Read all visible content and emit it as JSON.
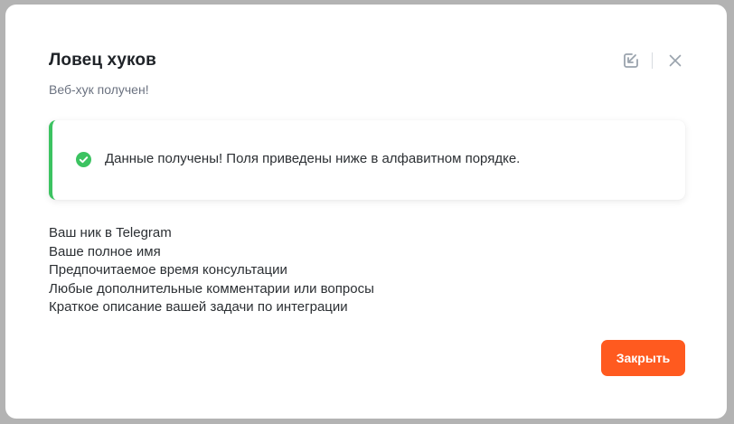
{
  "modal": {
    "title": "Ловец хуков",
    "subtitle": "Веб-хук получен!"
  },
  "header_actions": {
    "icons": [
      "open-external-icon",
      "close-icon"
    ]
  },
  "alert": {
    "status": "success",
    "icon": "check-circle-icon",
    "accent_color": "#3cc361",
    "text": "Данные получены! Поля приведены ниже в алфавитном порядке."
  },
  "fields": [
    {
      "label": "Ваш ник в Telegram"
    },
    {
      "label": "Ваше полное имя"
    },
    {
      "label": "Предпочитаемое время консультации"
    },
    {
      "label": "Любые дополнительные комментарии или вопросы"
    },
    {
      "label": "Краткое описание вашей задачи по интеграции"
    }
  ],
  "footer": {
    "close_label": "Закрыть",
    "close_color": "#ff5a1f"
  }
}
